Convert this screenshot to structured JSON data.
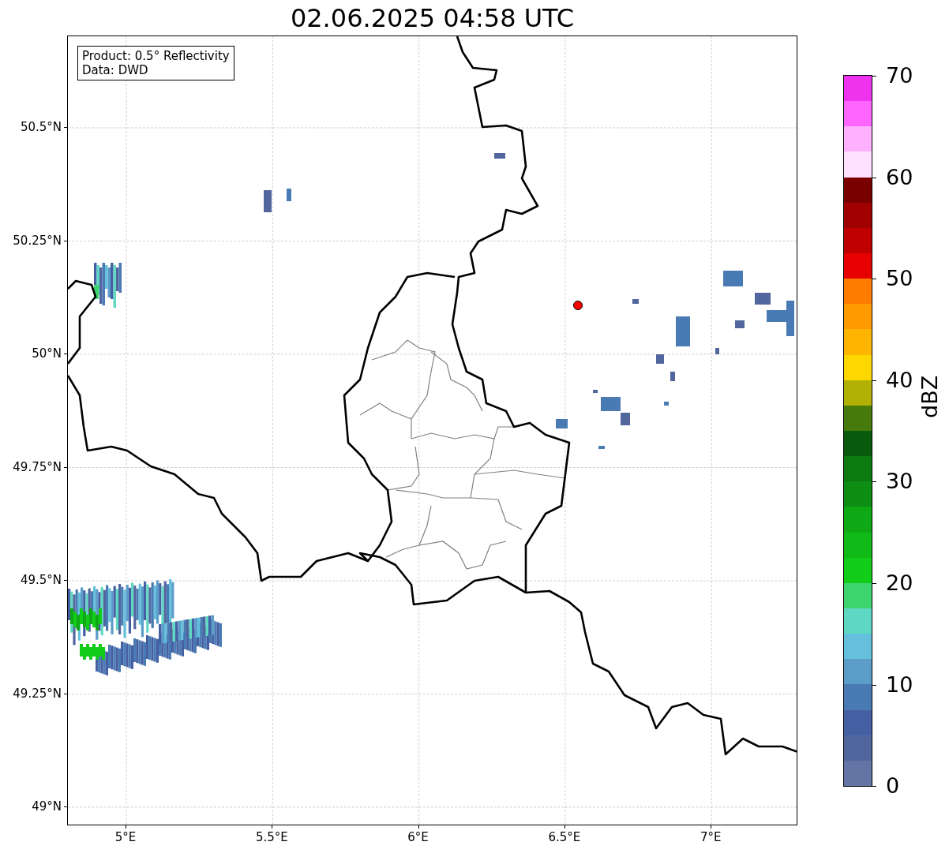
{
  "title": "02.06.2025 04:58 UTC",
  "info_box": {
    "lines": [
      "Product: 0.5° Reflectivity",
      "Data: DWD"
    ]
  },
  "y_axis": {
    "ticks": [
      "50.5°N",
      "50.25°N",
      "50°N",
      "49.75°N",
      "49.5°N",
      "49.25°N",
      "49°N"
    ]
  },
  "x_axis": {
    "ticks": [
      "5°E",
      "5.5°E",
      "6°E",
      "6.5°E",
      "7°E"
    ]
  },
  "colorbar": {
    "label": "dBZ",
    "ticks": [
      "70",
      "60",
      "50",
      "40",
      "30",
      "20",
      "10",
      "0"
    ],
    "bins": [
      {
        "color": "#ee33ee"
      },
      {
        "color": "#ff66ff"
      },
      {
        "color": "#ffb0ff"
      },
      {
        "color": "#ffe0ff"
      },
      {
        "color": "#7a0000"
      },
      {
        "color": "#a00000"
      },
      {
        "color": "#c00000"
      },
      {
        "color": "#e60000"
      },
      {
        "color": "#ff7c00"
      },
      {
        "color": "#ff9a00"
      },
      {
        "color": "#ffb500"
      },
      {
        "color": "#ffd700"
      },
      {
        "color": "#b1b004"
      },
      {
        "color": "#467a0a"
      },
      {
        "color": "#085b0c"
      },
      {
        "color": "#0b7a0f"
      },
      {
        "color": "#0d8e13"
      },
      {
        "color": "#0fa915"
      },
      {
        "color": "#10bb18"
      },
      {
        "color": "#12cc1a"
      },
      {
        "color": "#3cd46c"
      },
      {
        "color": "#5ed7c3"
      },
      {
        "color": "#64c0dc"
      },
      {
        "color": "#5b9cc8"
      },
      {
        "color": "#4a7ab3"
      },
      {
        "color": "#4460a3"
      },
      {
        "color": "#52669e"
      },
      {
        "color": "#6474a4"
      }
    ]
  }
}
